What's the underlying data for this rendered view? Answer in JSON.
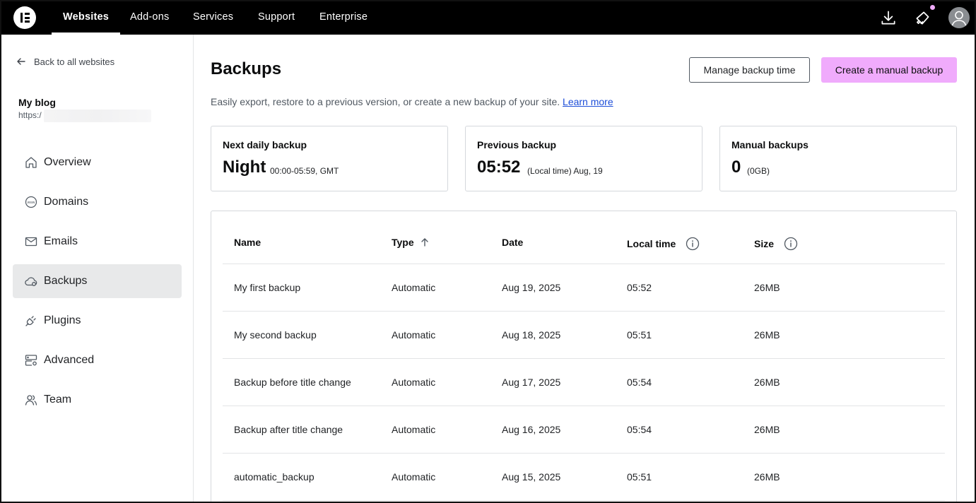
{
  "nav": {
    "items": [
      "Websites",
      "Add-ons",
      "Services",
      "Support",
      "Enterprise"
    ],
    "active": "Websites"
  },
  "icons": {
    "logo": "elementor-logo-icon",
    "download": "download-icon",
    "announcements": "megaphone-icon",
    "avatar": "user-avatar-icon",
    "info": "info-icon",
    "sort": "arrow-up-icon"
  },
  "colors": {
    "accent": "#f0abfc",
    "link": "#1d4ed8",
    "topbar": "#000000"
  },
  "sidebar": {
    "back_label": "Back to all websites",
    "site_name": "My blog",
    "site_url": "https:/",
    "items": [
      {
        "label": "Overview",
        "icon": "home-icon"
      },
      {
        "label": "Domains",
        "icon": "globe-www-icon"
      },
      {
        "label": "Emails",
        "icon": "mail-icon"
      },
      {
        "label": "Backups",
        "icon": "cloud-icon"
      },
      {
        "label": "Plugins",
        "icon": "plug-icon"
      },
      {
        "label": "Advanced",
        "icon": "server-settings-icon"
      },
      {
        "label": "Team",
        "icon": "users-icon"
      }
    ],
    "active": "Backups"
  },
  "main": {
    "title": "Backups",
    "manage_button": "Manage backup time",
    "create_button": "Create a manual backup",
    "description": "Easily export, restore to a previous version, or create a new backup of your site.",
    "learn_more": "Learn more",
    "cards": [
      {
        "label": "Next daily backup",
        "value": "Night",
        "detail": "00:00-05:59, GMT"
      },
      {
        "label": "Previous backup",
        "value": "05:52",
        "detail": "(Local time) Aug, 19"
      },
      {
        "label": "Manual backups",
        "value": "0",
        "detail": "(0GB)"
      }
    ],
    "table": {
      "headers": [
        "Name",
        "Type",
        "Date",
        "Local time",
        "Size"
      ],
      "rows": [
        [
          "My first backup",
          "Automatic",
          "Aug 19, 2025",
          "05:52",
          "26MB"
        ],
        [
          "My second backup",
          "Automatic",
          "Aug 18, 2025",
          "05:51",
          "26MB"
        ],
        [
          "Backup before title change",
          "Automatic",
          "Aug 17, 2025",
          "05:54",
          "26MB"
        ],
        [
          "Backup after title change",
          "Automatic",
          "Aug 16, 2025",
          "05:54",
          "26MB"
        ],
        [
          "automatic_backup",
          "Automatic",
          "Aug 15, 2025",
          "05:51",
          "26MB"
        ]
      ]
    }
  }
}
